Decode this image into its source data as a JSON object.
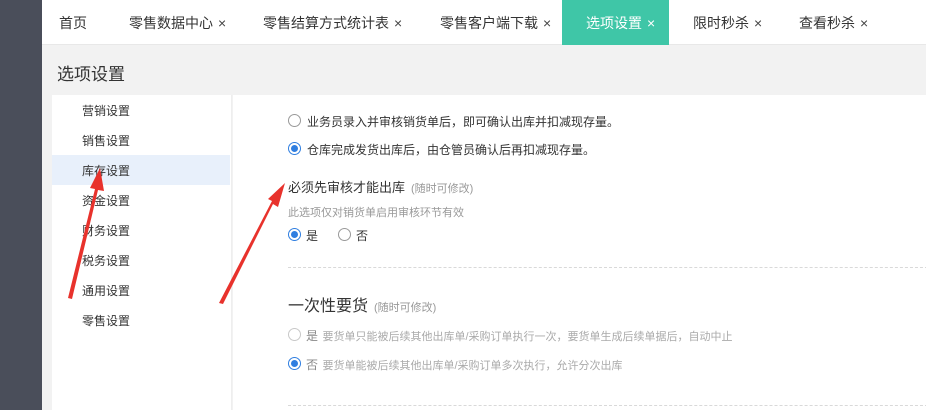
{
  "tabs": [
    {
      "label": "首页",
      "closable": false,
      "active": false
    },
    {
      "label": "零售数据中心",
      "closable": true,
      "active": false
    },
    {
      "label": "零售结算方式统计表",
      "closable": true,
      "active": false
    },
    {
      "label": "零售客户端下载",
      "closable": true,
      "active": false
    },
    {
      "label": "选项设置",
      "closable": true,
      "active": true
    },
    {
      "label": "限时秒杀",
      "closable": true,
      "active": false
    },
    {
      "label": "查看秒杀",
      "closable": true,
      "active": false
    }
  ],
  "close_glyph": "×",
  "page_title": "选项设置",
  "sidebar": {
    "items": [
      {
        "label": "营销设置"
      },
      {
        "label": "销售设置"
      },
      {
        "label": "库存设置",
        "active": true
      },
      {
        "label": "资金设置"
      },
      {
        "label": "财务设置"
      },
      {
        "label": "税务设置"
      },
      {
        "label": "通用设置"
      },
      {
        "label": "零售设置"
      }
    ]
  },
  "content": {
    "stock_reduce": {
      "option1": "业务员录入并审核销货单后，即可确认出库并扣减现存量。",
      "option2": "仓库完成发货出库后，由仓管员确认后再扣减现存量。",
      "selected": 2
    },
    "must_audit": {
      "title": "必须先审核才能出库",
      "hint": "(随时可修改)",
      "desc": "此选项仅对销货单启用审核环节有效",
      "yes": "是",
      "no": "否",
      "selected": "yes"
    },
    "one_time": {
      "title": "一次性要货",
      "hint": "(随时可修改)",
      "yes": "是",
      "yes_desc": "要货单只能被后续其他出库单/采购订单执行一次，要货单生成后续单据后，自动中止",
      "no": "否",
      "no_desc": "要货单能被后续其他出库单/采购订单多次执行，允许分次出库",
      "selected": "no"
    }
  },
  "colors": {
    "accent": "#3fc6a7",
    "radio_blue": "#2f7ee0",
    "arrow_red": "#e8322c",
    "rail": "#4a4e5a"
  }
}
